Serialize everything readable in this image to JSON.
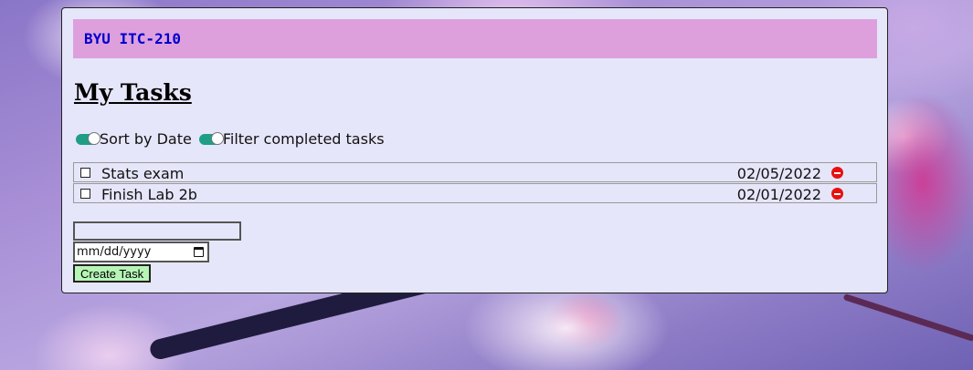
{
  "header": {
    "brand": "BYU ITC-210"
  },
  "main": {
    "title": "My Tasks",
    "toggles": [
      {
        "label": "Sort by Date",
        "on": true
      },
      {
        "label": "Filter completed tasks",
        "on": true
      }
    ],
    "tasks": [
      {
        "name": "Stats exam",
        "date": "02/05/2022",
        "completed": false
      },
      {
        "name": "Finish Lab 2b",
        "date": "02/01/2022",
        "completed": false
      }
    ]
  },
  "form": {
    "task_name_value": "",
    "date_placeholder": "mm/dd/yyyy",
    "create_label": "Create Task"
  },
  "icons": {
    "delete": "minus-circle-icon",
    "calendar": "calendar-icon"
  },
  "colors": {
    "panel_bg": "#e6e6fa",
    "header_bg": "#dda0dd",
    "brand_text": "#0000cd",
    "toggle_on": "#1f9e86",
    "delete_red": "#e81010",
    "create_button_bg": "#b6f5b6"
  }
}
